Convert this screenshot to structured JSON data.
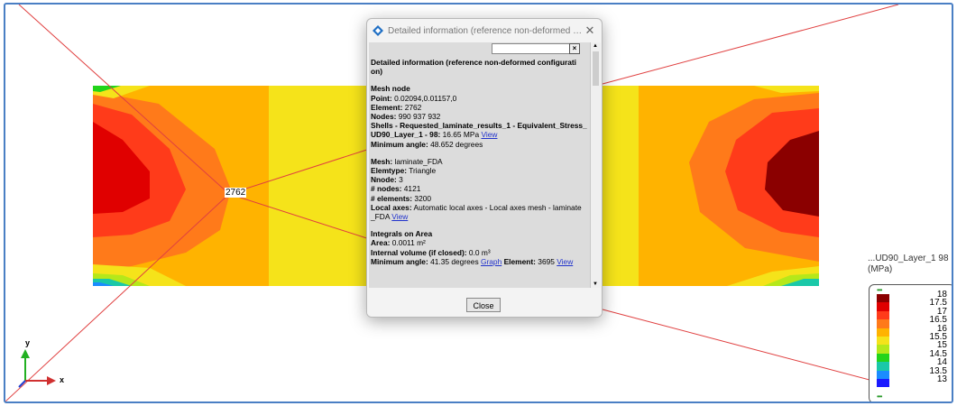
{
  "viewport": {
    "node_label": "2762",
    "axis_y": "y",
    "axis_x": "x"
  },
  "legend": {
    "title_line1": "...UD90_Layer_1  98",
    "title_line2": "(MPa)",
    "values": [
      "18",
      "17.5",
      "17",
      "16.5",
      "16",
      "15.5",
      "15",
      "14.5",
      "14",
      "13.5",
      "13"
    ],
    "colors": [
      "#8b0000",
      "#e00000",
      "#ff3b1a",
      "#ff7a1a",
      "#ffb300",
      "#f5e31a",
      "#b5e81a",
      "#22d41a",
      "#1ac8a8",
      "#1a8cff",
      "#1a1aff"
    ],
    "dots": "•••"
  },
  "dialog": {
    "title": "Detailed information (reference non-deformed config...",
    "close_glyph": "✕",
    "heading": "Detailed information (reference non-deformed configurati on)",
    "mesh_node_title": "Mesh node",
    "point_label": "Point:",
    "point_value": "0.02094,0.01157,0",
    "element_label": "Element:",
    "element_value": "2762",
    "nodes_label": "Nodes:",
    "nodes_value": "990 937 932",
    "shells_line": "Shells - Requested_laminate_results_1 - Equivalent_Stress_",
    "ud90_label": "UD90_Layer_1 - 98:",
    "ud90_value": "16.65 MPa",
    "view_link": "View",
    "min_angle_label": "Minimum angle:",
    "min_angle_value": "48.652 degrees",
    "mesh_label": "Mesh:",
    "mesh_value": "laminate_FDA",
    "elemtype_label": "Elemtype:",
    "elemtype_value": "Triangle",
    "nnode_label": "Nnode:",
    "nnode_value": "3",
    "num_nodes_label": "# nodes:",
    "num_nodes_value": "4121",
    "num_elements_label": "# elements:",
    "num_elements_value": "3200",
    "local_axes_label": "Local axes:",
    "local_axes_value": "Automatic local axes - Local axes mesh - laminate",
    "local_axes_value2": "_FDA",
    "integrals_title": "Integrals on Area",
    "area_label": "Area:",
    "area_value": "0.0011 m²",
    "volume_label": "Internal volume (if closed):",
    "volume_value": "0.0 m³",
    "min_angle2_label": "Minimum angle:",
    "min_angle2_value": "41.35 degrees",
    "graph_link": "Graph",
    "element2_label": "Element:",
    "element2_value": "3695",
    "close_button": "Close"
  }
}
